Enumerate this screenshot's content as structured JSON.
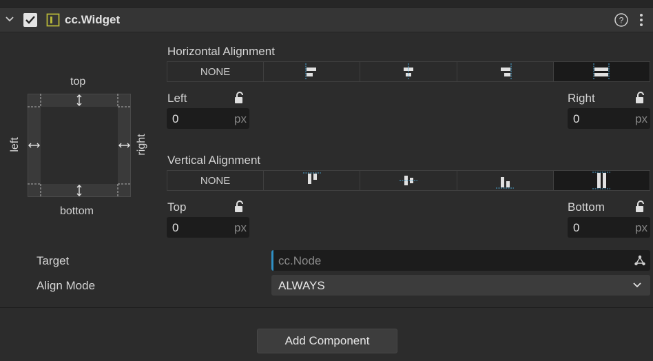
{
  "component": {
    "title": "cc.Widget",
    "enabled": true
  },
  "diagram": {
    "top": "top",
    "bottom": "bottom",
    "left": "left",
    "right": "right"
  },
  "horizontal": {
    "title": "Horizontal Alignment",
    "options": [
      "NONE",
      "align-left-icon",
      "align-h-center-icon",
      "align-right-icon",
      "align-h-stretch-icon"
    ],
    "selected": 4,
    "left_label": "Left",
    "left_value": "0",
    "right_label": "Right",
    "right_value": "0",
    "unit": "px"
  },
  "vertical": {
    "title": "Vertical Alignment",
    "options": [
      "NONE",
      "align-top-icon",
      "align-v-center-icon",
      "align-bottom-icon",
      "align-v-stretch-icon"
    ],
    "selected": 4,
    "top_label": "Top",
    "top_value": "0",
    "bottom_label": "Bottom",
    "bottom_value": "0",
    "unit": "px"
  },
  "target": {
    "label": "Target",
    "placeholder": "cc.Node"
  },
  "align_mode": {
    "label": "Align Mode",
    "value": "ALWAYS"
  },
  "add_component": "Add Component"
}
